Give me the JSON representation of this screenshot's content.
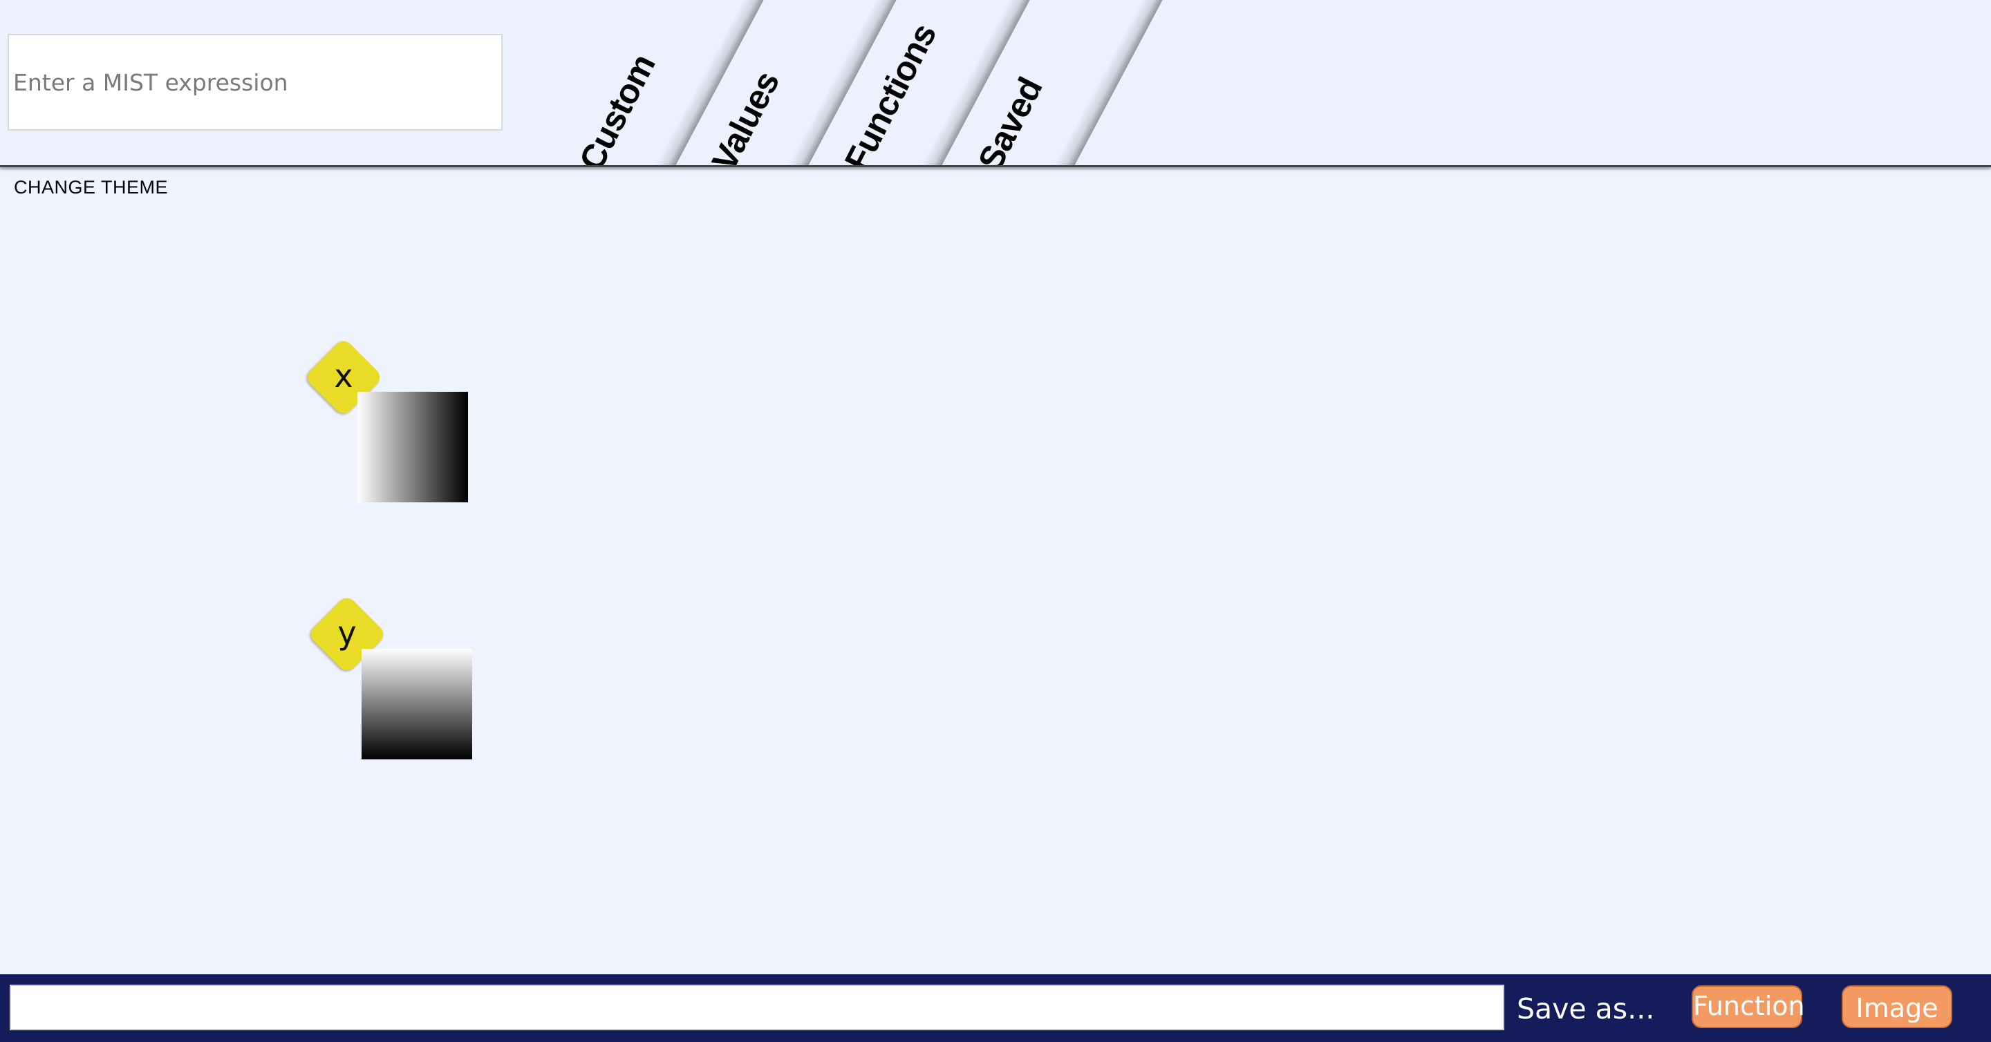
{
  "header": {
    "expression_placeholder": "Enter a MIST expression",
    "tabs": [
      {
        "label": "Custom"
      },
      {
        "label": "Values"
      },
      {
        "label": "Functions"
      },
      {
        "label": "Saved"
      }
    ]
  },
  "theme": {
    "change_label": "CHANGE THEME"
  },
  "workspace": {
    "nodes": [
      {
        "label": "x",
        "preview": "horizontal-gradient"
      },
      {
        "label": "y",
        "preview": "vertical-gradient"
      }
    ]
  },
  "footer": {
    "name_value": "",
    "save_as_label": "Save as...",
    "function_button": "Function",
    "image_button": "Image"
  },
  "colors": {
    "node_accent": "#e9dc26",
    "footer_bg": "#151c5c",
    "button_bg": "#f39a62"
  }
}
